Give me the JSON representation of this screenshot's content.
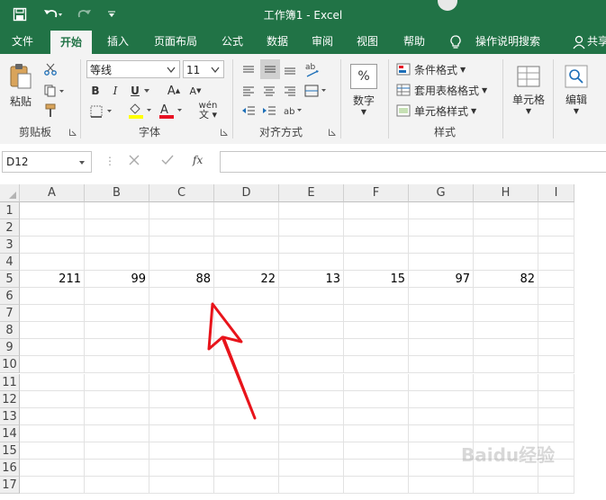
{
  "window": {
    "title": "工作簿1 - Excel"
  },
  "quick_access": {
    "save_icon": "save-icon",
    "undo_icon": "undo-icon",
    "redo_icon": "redo-icon",
    "customize_icon": "customize-icon"
  },
  "tabs": [
    {
      "label": "文件"
    },
    {
      "label": "开始"
    },
    {
      "label": "插入"
    },
    {
      "label": "页面布局"
    },
    {
      "label": "公式"
    },
    {
      "label": "数据"
    },
    {
      "label": "审阅"
    },
    {
      "label": "视图"
    },
    {
      "label": "帮助"
    },
    {
      "label": "操作说明搜索"
    },
    {
      "label": "共享"
    }
  ],
  "ribbon": {
    "clipboard": {
      "paste": "粘贴",
      "group": "剪贴板"
    },
    "font": {
      "name": "等线",
      "size": "11",
      "group": "字体",
      "phonetic": "wén"
    },
    "alignment": {
      "group": "对齐方式"
    },
    "number": {
      "label": "数字",
      "symbol": "%"
    },
    "styles": {
      "conditional": "条件格式",
      "table": "套用表格格式",
      "cell_styles": "单元格样式",
      "group": "样式"
    },
    "cells": {
      "label": "单元格"
    },
    "editing": {
      "label": "编辑"
    }
  },
  "formula_bar": {
    "name_box": "D12",
    "fx": "fx",
    "content": ""
  },
  "sheet": {
    "columns": [
      "A",
      "B",
      "C",
      "D",
      "E",
      "F",
      "G",
      "H",
      "I"
    ],
    "rows": [
      "1",
      "2",
      "3",
      "4",
      "5",
      "6",
      "7",
      "8",
      "9",
      "10",
      "11",
      "12",
      "13",
      "14",
      "15",
      "16",
      "17"
    ],
    "row5": [
      "211",
      "99",
      "88",
      "22",
      "13",
      "15",
      "97",
      "82",
      ""
    ]
  },
  "colors": {
    "brand": "#217346",
    "arrow": "#e8141b"
  },
  "watermark": "Baidu经验"
}
